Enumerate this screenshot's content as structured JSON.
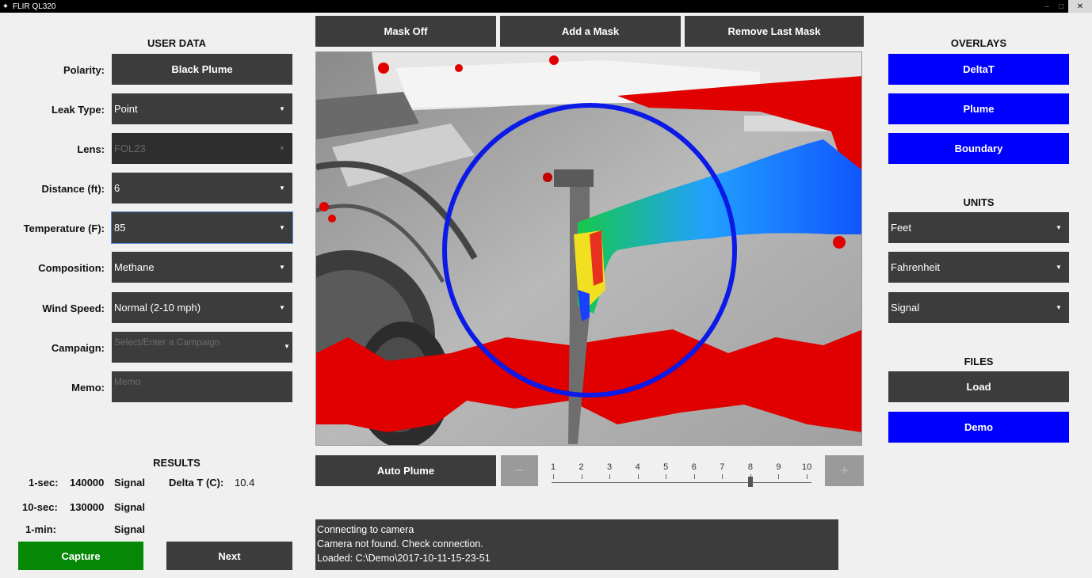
{
  "window": {
    "title": "FLIR QL320"
  },
  "toolbar": {
    "mask_off": "Mask Off",
    "add_mask": "Add a Mask",
    "remove_last_mask": "Remove Last Mask"
  },
  "user_data": {
    "title": "USER DATA",
    "polarity": {
      "label": "Polarity:",
      "value": "Black Plume"
    },
    "leak_type": {
      "label": "Leak Type:",
      "value": "Point"
    },
    "lens": {
      "label": "Lens:",
      "value": "FOL23"
    },
    "distance": {
      "label": "Distance (ft):",
      "value": "6"
    },
    "temperature": {
      "label": "Temperature (F):",
      "value": "85"
    },
    "composition": {
      "label": "Composition:",
      "value": "Methane"
    },
    "wind_speed": {
      "label": "Wind Speed:",
      "value": "Normal (2-10 mph)"
    },
    "campaign": {
      "label": "Campaign:",
      "placeholder": "Select/Enter a Campaign"
    },
    "memo": {
      "label": "Memo:",
      "placeholder": "Memo"
    }
  },
  "results": {
    "title": "RESULTS",
    "one_sec": {
      "label": "1-sec:",
      "value": "140000",
      "unit": "Signal"
    },
    "ten_sec": {
      "label": "10-sec:",
      "value": "130000",
      "unit": "Signal"
    },
    "one_min": {
      "label": "1-min:",
      "value": "",
      "unit": "Signal"
    },
    "delta_t": {
      "label": "Delta T (C):",
      "value": "10.4"
    }
  },
  "actions": {
    "capture": "Capture",
    "next": "Next"
  },
  "plume": {
    "auto_label": "Auto Plume",
    "minus_label": "−",
    "plus_label": "+",
    "ticks": [
      "1",
      "2",
      "3",
      "4",
      "5",
      "6",
      "7",
      "8",
      "9",
      "10"
    ],
    "value": 8
  },
  "status": {
    "lines": [
      "Connecting to camera",
      "Camera not found. Check connection.",
      "Loaded: C:\\Demo\\2017-10-11-15-23-51"
    ]
  },
  "overlays": {
    "title": "OVERLAYS",
    "delta_t": "DeltaT",
    "plume": "Plume",
    "boundary": "Boundary"
  },
  "units": {
    "title": "UNITS",
    "distance": "Feet",
    "temperature": "Fahrenheit",
    "signal": "Signal"
  },
  "files": {
    "title": "FILES",
    "load": "Load",
    "demo": "Demo"
  },
  "colors": {
    "accent_blue": "#0000ff",
    "capture_green": "#058805",
    "panel_dark": "#3c3c3c",
    "overlay_red": "#e00000"
  }
}
